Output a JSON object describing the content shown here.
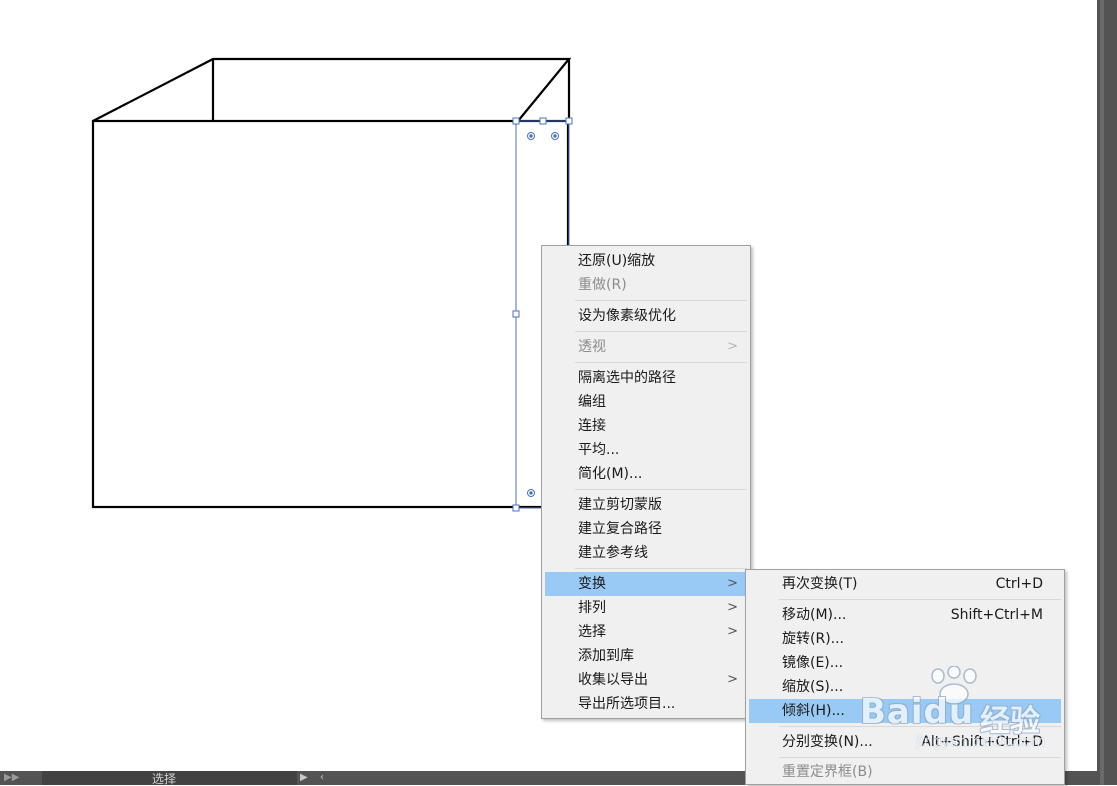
{
  "status_bar": {
    "tool_status": "选择"
  },
  "context_menu": {
    "items": [
      {
        "label": "还原(U)缩放",
        "disabled": false
      },
      {
        "label": "重做(R)",
        "disabled": true
      },
      {
        "label": "设为像素级优化",
        "disabled": false
      },
      {
        "label": "透视",
        "disabled": true,
        "has_submenu": true
      },
      {
        "label": "隔离选中的路径",
        "disabled": false
      },
      {
        "label": "编组",
        "disabled": false
      },
      {
        "label": "连接",
        "disabled": false
      },
      {
        "label": "平均...",
        "disabled": false
      },
      {
        "label": "简化(M)...",
        "disabled": false
      },
      {
        "label": "建立剪切蒙版",
        "disabled": false
      },
      {
        "label": "建立复合路径",
        "disabled": false
      },
      {
        "label": "建立参考线",
        "disabled": false
      },
      {
        "label": "变换",
        "disabled": false,
        "has_submenu": true,
        "highlighted": true
      },
      {
        "label": "排列",
        "disabled": false,
        "has_submenu": true
      },
      {
        "label": "选择",
        "disabled": false,
        "has_submenu": true
      },
      {
        "label": "添加到库",
        "disabled": false
      },
      {
        "label": "收集以导出",
        "disabled": false,
        "has_submenu": true
      },
      {
        "label": "导出所选项目...",
        "disabled": false
      }
    ]
  },
  "transform_submenu": {
    "items": [
      {
        "label": "再次变换(T)",
        "shortcut": "Ctrl+D"
      },
      {
        "label": "移动(M)...",
        "shortcut": "Shift+Ctrl+M"
      },
      {
        "label": "旋转(R)...",
        "shortcut": ""
      },
      {
        "label": "镜像(E)...",
        "shortcut": ""
      },
      {
        "label": "缩放(S)...",
        "shortcut": ""
      },
      {
        "label": "倾斜(H)...",
        "shortcut": "",
        "highlighted": true
      },
      {
        "label": "分别变换(N)...",
        "shortcut": "Alt+Shift+Ctrl+D"
      },
      {
        "label": "重置定界框(B)",
        "shortcut": "",
        "disabled": true
      }
    ]
  },
  "watermark": {
    "brand": "Baidu",
    "brand_cn": "经验",
    "url": "jingyan.baidu.com"
  },
  "colors": {
    "menu_background": "#f0f0f0",
    "menu_highlight": "#99c9f5",
    "selection_blue": "#4a72c4",
    "dark_ui": "#535353"
  }
}
